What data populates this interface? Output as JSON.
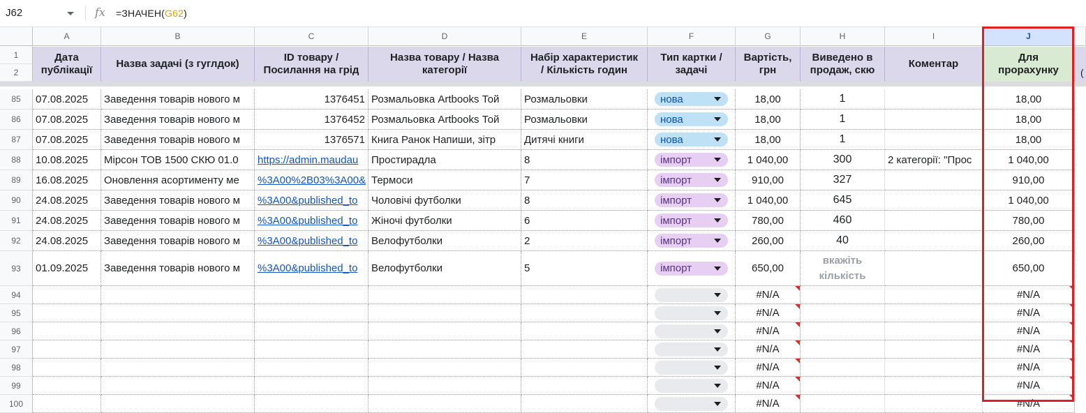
{
  "formula_bar": {
    "cell_ref": "J62",
    "fx_label": "fx",
    "formula_prefix": "=ЗНАЧЕН(",
    "formula_ref": "G62",
    "formula_suffix": ")"
  },
  "columns": [
    "A",
    "B",
    "C",
    "D",
    "E",
    "F",
    "G",
    "H",
    "I",
    "J"
  ],
  "selected_column": "J",
  "header_row_numbers": [
    "1",
    "2"
  ],
  "headers": {
    "A": "Дата\nпублікації",
    "B": "Назва задачі (з гуглдок)",
    "C": "ID товару /\nПосилання на грід",
    "D": "Назва товару / Назва\nкатегорії",
    "E": "Набір характеристик\n/ Кількість годин",
    "F": "Тип картки /\nзадачі",
    "G": "Вартість,\nгрн",
    "H": "Виведено в\nпродаж, скю",
    "I": "Коментар",
    "J": "Для\nпрорахунку"
  },
  "extra_col_glyph": "(",
  "rows": [
    {
      "num": "85",
      "A": "07.08.2025",
      "B": "Заведення товарів нового м",
      "C": "1376451",
      "D": "Розмальовка Artbooks Той",
      "E": "Розмальовки",
      "F": "нова",
      "G": "18,00",
      "H": "1",
      "I": "",
      "J": "18,00"
    },
    {
      "num": "86",
      "A": "07.08.2025",
      "B": "Заведення товарів нового м",
      "C": "1376452",
      "D": "Розмальовка Artbooks Той",
      "E": "Розмальовки",
      "F": "нова",
      "G": "18,00",
      "H": "1",
      "I": "",
      "J": "18,00"
    },
    {
      "num": "87",
      "A": "07.08.2025",
      "B": "Заведення товарів нового м",
      "C": "1376571",
      "D": "Книга Ранок Напиши, зітр",
      "E": "Дитячі книги",
      "F": "нова",
      "G": "18,00",
      "H": "1",
      "I": "",
      "J": "18,00"
    },
    {
      "num": "88",
      "A": "10.08.2025",
      "B": "Мірсон ТОВ 1500 СКЮ 01.0",
      "C": "https://admin.maudau",
      "D": "Простирадла",
      "E": "8",
      "F": "імпорт",
      "G": "1 040,00",
      "H": "300",
      "I": "2 категорії: \"Прос",
      "J": "1 040,00"
    },
    {
      "num": "89",
      "A": "16.08.2025",
      "B": "Оновлення асортименту ме",
      "C": "%3A00%2B03%3A00&",
      "D": "Термоси",
      "E": "7",
      "F": "імпорт",
      "G": "910,00",
      "H": "327",
      "I": "",
      "J": "910,00"
    },
    {
      "num": "90",
      "A": "24.08.2025",
      "B": "Заведення товарів нового м",
      "C": "%3A00&published_to",
      "D": "Чоловічі футболки",
      "E": "8",
      "F": "імпорт",
      "G": "1 040,00",
      "H": "645",
      "I": "",
      "J": "1 040,00"
    },
    {
      "num": "91",
      "A": "24.08.2025",
      "B": "Заведення товарів нового м",
      "C": "%3A00&published_to",
      "D": "Жіночі футболки",
      "E": "6",
      "F": "імпорт",
      "G": "780,00",
      "H": "460",
      "I": "",
      "J": "780,00"
    },
    {
      "num": "92",
      "A": "24.08.2025",
      "B": "Заведення товарів нового м",
      "C": "%3A00&published_to",
      "D": "Велофутболки",
      "E": "2",
      "F": "імпорт",
      "G": "260,00",
      "H": "40",
      "I": "",
      "J": "260,00"
    },
    {
      "num": "93",
      "A": "01.09.2025",
      "B": "Заведення товарів нового м",
      "C": "%3A00&published_to",
      "D": "Велофутболки",
      "E": "5",
      "F": "імпорт",
      "G": "650,00",
      "H": "вкажіть кількість",
      "I": "",
      "J": "650,00"
    },
    {
      "num": "94",
      "A": "",
      "B": "",
      "C": "",
      "D": "",
      "E": "",
      "F": "",
      "G": "#N/A",
      "H": "",
      "I": "",
      "J": "#N/A"
    },
    {
      "num": "95",
      "A": "",
      "B": "",
      "C": "",
      "D": "",
      "E": "",
      "F": "",
      "G": "#N/A",
      "H": "",
      "I": "",
      "J": "#N/A"
    },
    {
      "num": "96",
      "A": "",
      "B": "",
      "C": "",
      "D": "",
      "E": "",
      "F": "",
      "G": "#N/A",
      "H": "",
      "I": "",
      "J": "#N/A"
    },
    {
      "num": "97",
      "A": "",
      "B": "",
      "C": "",
      "D": "",
      "E": "",
      "F": "",
      "G": "#N/A",
      "H": "",
      "I": "",
      "J": "#N/A"
    },
    {
      "num": "98",
      "A": "",
      "B": "",
      "C": "",
      "D": "",
      "E": "",
      "F": "",
      "G": "#N/A",
      "H": "",
      "I": "",
      "J": "#N/A"
    },
    {
      "num": "99",
      "A": "",
      "B": "",
      "C": "",
      "D": "",
      "E": "",
      "F": "",
      "G": "#N/A",
      "H": "",
      "I": "",
      "J": "#N/A"
    },
    {
      "num": "100",
      "A": "",
      "B": "",
      "C": "",
      "D": "",
      "E": "",
      "F": "",
      "G": "#N/A",
      "H": "",
      "I": "",
      "J": "#N/A"
    }
  ],
  "colors": {
    "nova_chip": "#bfe1f6",
    "import_chip": "#e6cff2",
    "header_purple": "#dcd8ec",
    "header_green": "#d9ead3",
    "selection_red": "#e02020",
    "link": "#1155cc"
  }
}
